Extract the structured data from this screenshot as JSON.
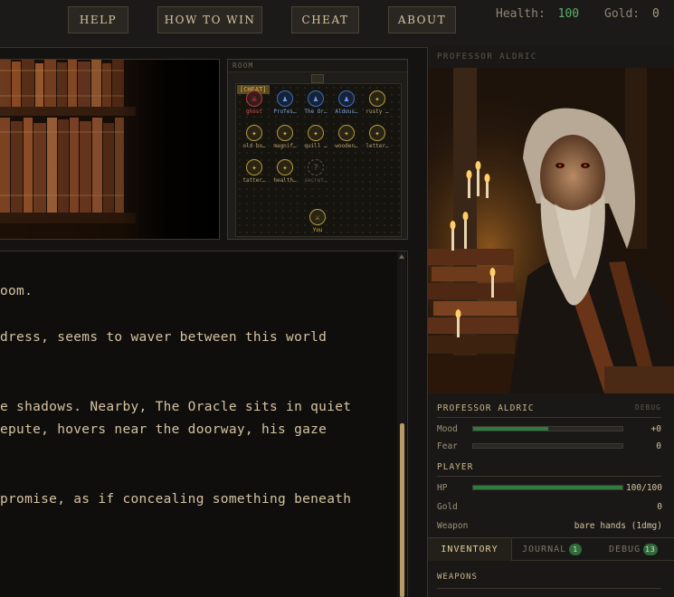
{
  "nav": {
    "buttons": [
      "HELP",
      "HOW TO WIN",
      "CHEAT",
      "ABOUT"
    ]
  },
  "stats": {
    "health_label": "Health:",
    "health_value": "100",
    "gold_label": "Gold:",
    "gold_value": "0"
  },
  "room": {
    "title": "ROOM",
    "cheat_tag": "[CHEAT]",
    "tokens": [
      {
        "label": "ghost",
        "kind": "red",
        "icon": "skull-icon",
        "glyph": "☠"
      },
      {
        "label": "Profes…",
        "kind": "blue",
        "icon": "person-icon",
        "glyph": "♟"
      },
      {
        "label": "The Or…",
        "kind": "blue",
        "icon": "person-icon",
        "glyph": "♟"
      },
      {
        "label": "Aldous…",
        "kind": "blue",
        "icon": "person-icon",
        "glyph": "♟"
      },
      {
        "label": "rusty …",
        "kind": "item",
        "icon": "item-icon",
        "glyph": "✦"
      },
      {
        "label": "old bo…",
        "kind": "item",
        "icon": "item-icon",
        "glyph": "✦"
      },
      {
        "label": "magnif…",
        "kind": "item",
        "icon": "item-icon",
        "glyph": "✦"
      },
      {
        "label": "quill …",
        "kind": "item",
        "icon": "item-icon",
        "glyph": "✦"
      },
      {
        "label": "wooden…",
        "kind": "item",
        "icon": "item-icon",
        "glyph": "✦"
      },
      {
        "label": "letter…",
        "kind": "item",
        "icon": "item-icon",
        "glyph": "✦"
      },
      {
        "label": "tatter…",
        "kind": "item",
        "icon": "item-icon",
        "glyph": "✦"
      },
      {
        "label": "health…",
        "kind": "item",
        "icon": "item-icon",
        "glyph": "✦"
      },
      {
        "label": "secret…",
        "kind": "dim",
        "icon": "question-icon",
        "glyph": "?"
      }
    ],
    "player": {
      "label": "You",
      "icon": "swords-icon",
      "glyph": "⚔"
    }
  },
  "story": {
    "lines": [
      "oom.",
      " dress, seems to waver between this world",
      "e shadows. Nearby, The Oracle sits in quiet",
      "epute, hovers near the doorway, his gaze",
      "promise, as if concealing something beneath"
    ]
  },
  "npc": {
    "portrait_title": "PROFESSOR ALDRIC",
    "name": "PROFESSOR ALDRIC",
    "debug_label": "DEBUG",
    "mood_label": "Mood",
    "mood_value": "+0",
    "mood_fill": 0.5,
    "fear_label": "Fear",
    "fear_value": "0",
    "fear_fill": 0
  },
  "player": {
    "section_title": "PLAYER",
    "hp_label": "HP",
    "hp_value": "100/100",
    "hp_fill": 1,
    "gold_label": "Gold",
    "gold_value": "0",
    "weapon_label": "Weapon",
    "weapon_value": "bare hands (1dmg)"
  },
  "tabs": [
    {
      "label": "INVENTORY",
      "badge": ""
    },
    {
      "label": "JOURNAL",
      "badge": "1"
    },
    {
      "label": "DEBUG",
      "badge": "13"
    }
  ],
  "inventory": {
    "section_title": "WEAPONS"
  },
  "colors": {
    "accent": "#c9b48a",
    "health": "#5fae6a",
    "bar_fill": "#2f7a3e",
    "badge": "#2f6a3a"
  }
}
